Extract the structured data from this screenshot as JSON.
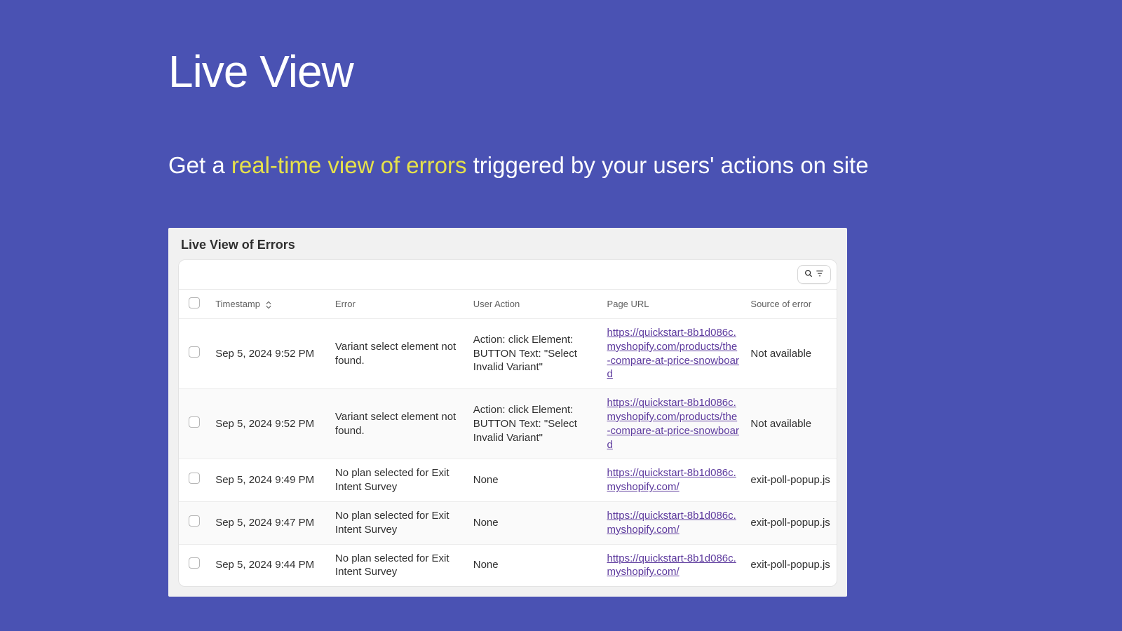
{
  "hero": {
    "title": "Live View",
    "sub_before": "Get a ",
    "sub_accent": "real-time view of errors",
    "sub_after": " triggered by your users' actions on site"
  },
  "panel": {
    "title": "Live View of Errors",
    "columns": {
      "timestamp": "Timestamp",
      "error": "Error",
      "user_action": "User Action",
      "page_url": "Page URL",
      "source": "Source of error"
    },
    "rows": [
      {
        "timestamp": "Sep 5, 2024 9:52 PM",
        "error": "Variant select element not found.",
        "user_action": "Action: click Element: BUTTON Text: \"Select Invalid Variant\"",
        "page_url": "https://quickstart-8b1d086c.myshopify.com/products/the-compare-at-price-snowboard",
        "source": "Not available"
      },
      {
        "timestamp": "Sep 5, 2024 9:52 PM",
        "error": "Variant select element not found.",
        "user_action": "Action: click Element: BUTTON Text: \"Select Invalid Variant\"",
        "page_url": "https://quickstart-8b1d086c.myshopify.com/products/the-compare-at-price-snowboard",
        "source": "Not available"
      },
      {
        "timestamp": "Sep 5, 2024 9:49 PM",
        "error": "No plan selected for Exit Intent Survey",
        "user_action": "None",
        "page_url": "https://quickstart-8b1d086c.myshopify.com/",
        "source": "exit-poll-popup.js"
      },
      {
        "timestamp": "Sep 5, 2024 9:47 PM",
        "error": "No plan selected for Exit Intent Survey",
        "user_action": "None",
        "page_url": "https://quickstart-8b1d086c.myshopify.com/",
        "source": "exit-poll-popup.js"
      },
      {
        "timestamp": "Sep 5, 2024 9:44 PM",
        "error": "No plan selected for Exit Intent Survey",
        "user_action": "None",
        "page_url": "https://quickstart-8b1d086c.myshopify.com/",
        "source": "exit-poll-popup.js"
      }
    ]
  }
}
